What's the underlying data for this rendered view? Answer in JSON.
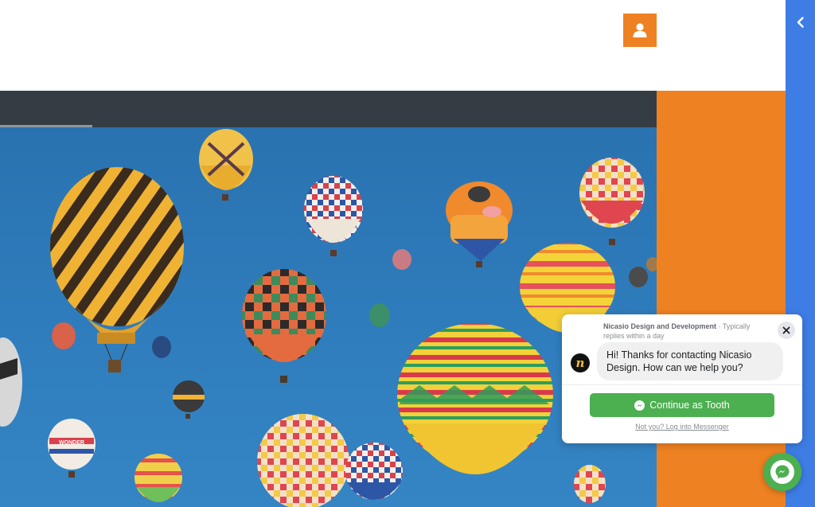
{
  "header": {
    "user_button_icon": "user-icon",
    "accent_color": "#ee8122"
  },
  "sidebar": {
    "toggle_icon": "chevron-left-icon",
    "color": "#3d7de4"
  },
  "nav": {
    "progress_fraction": 0.14
  },
  "hero": {
    "image": "hot-air-balloons-photo"
  },
  "chat": {
    "page_name": "Nicasio Design and Development",
    "separator": "·",
    "reply_time": "Typically replies within a day",
    "avatar_letter": "n",
    "message": "Hi! Thanks for contacting Nicasio Design. How can we help you?",
    "continue_label": "Continue as Tooth",
    "login_link": "Not you? Log into Messenger",
    "close_icon": "close-icon",
    "button_color": "#4caf50"
  },
  "messenger": {
    "icon": "messenger-icon"
  }
}
